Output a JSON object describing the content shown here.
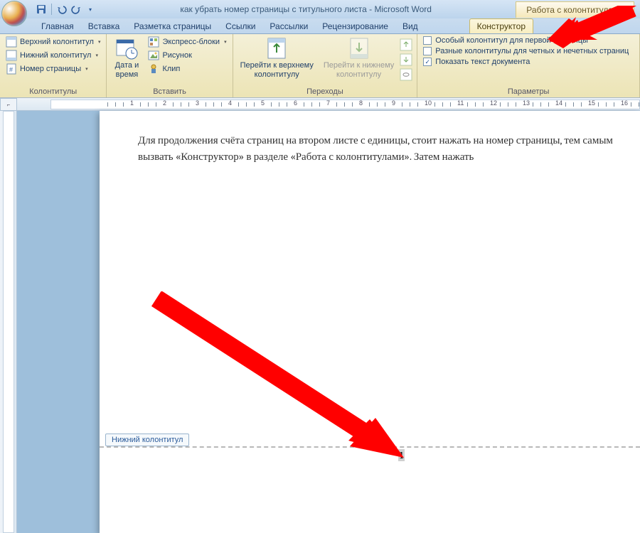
{
  "window": {
    "doc_title": "как убрать номер страницы с титульного листа",
    "app_name": "Microsoft Word",
    "contextual_tab": "Работа с колонтитулами"
  },
  "tabs": {
    "home": "Главная",
    "insert": "Вставка",
    "page_layout": "Разметка страницы",
    "references": "Ссылки",
    "mailings": "Рассылки",
    "review": "Рецензирование",
    "view": "Вид",
    "design": "Конструктор"
  },
  "ribbon": {
    "colontitles": {
      "header": "Верхний колонтитул",
      "footer": "Нижний колонтитул",
      "page_number": "Номер страницы",
      "group": "Колонтитулы"
    },
    "insert": {
      "date_time": "Дата и\nвремя",
      "quick_parts": "Экспресс-блоки",
      "picture": "Рисунок",
      "clip": "Клип",
      "group": "Вставить"
    },
    "navigation": {
      "goto_header": "Перейти к верхнему\nколонтитулу",
      "goto_footer": "Перейти к нижнему\nколонтитулу",
      "group": "Переходы"
    },
    "options": {
      "diff_first": "Особый колонтитул для первой страницы",
      "diff_odd_even": "Разные колонтитулы для четных и нечетных страниц",
      "show_doc": "Показать текст документа",
      "group": "Параметры"
    }
  },
  "ruler": {
    "marks": [
      "1",
      "·",
      "1",
      "·",
      "2",
      "·",
      "3",
      "·",
      "4",
      "·",
      "5",
      "·",
      "6",
      "·",
      "7",
      "·",
      "8",
      "·",
      "9",
      "·",
      "10",
      "·",
      "11",
      "·",
      "12",
      "·",
      "13",
      "·",
      "14",
      "·",
      "15",
      "·",
      "16",
      "·"
    ]
  },
  "document": {
    "paragraph": "Для продолжения счёта страниц на втором листе с единицы, стоит нажать на номер страницы, тем самым вызвать «Конструктор» в разделе «Работа с колонтитулами». Затем нажать",
    "footer_label": "Нижний колонтитул",
    "page_number": "1"
  },
  "options_state": {
    "diff_first_checked": false,
    "diff_odd_even_checked": false,
    "show_doc_checked": true
  }
}
